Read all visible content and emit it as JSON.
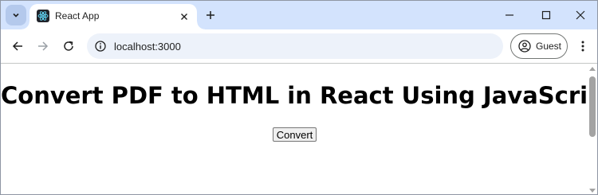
{
  "browser": {
    "tab": {
      "title": "React App",
      "favicon": "react-logo-icon"
    },
    "window_controls": [
      "minimize-icon",
      "maximize-icon",
      "close-icon"
    ],
    "nav": [
      "back-arrow-icon",
      "forward-arrow-icon",
      "reload-icon"
    ],
    "omnibox": {
      "url": "localhost:3000",
      "site_info_icon": "info-icon"
    },
    "profile": {
      "label": "Guest",
      "icon": "person-circle-icon"
    },
    "menu_icon": "kebab-menu-icon",
    "colors": {
      "tabstrip": "#d3e3fd",
      "omnibox": "#edf2fa",
      "scrollbar_thumb": "#a3a3a3"
    }
  },
  "page": {
    "heading": "Convert PDF to HTML in React Using JavaScript",
    "convert_button": "Convert"
  }
}
